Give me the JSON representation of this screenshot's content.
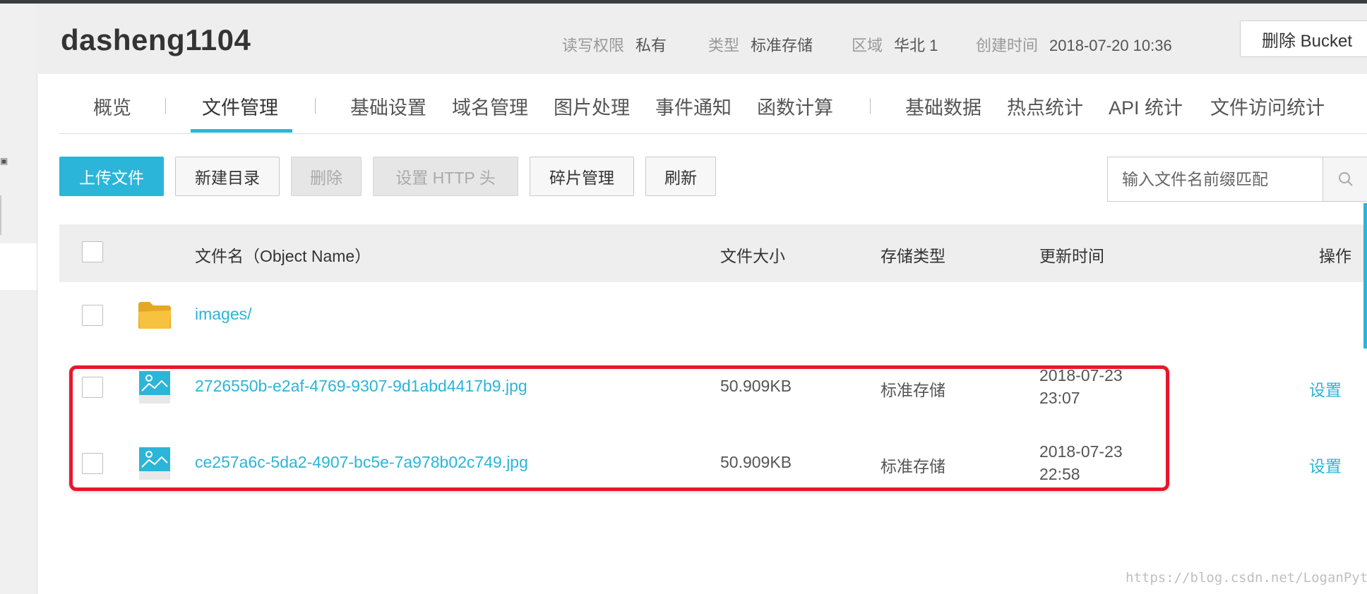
{
  "bucket": {
    "name": "dasheng1104",
    "meta": [
      {
        "key": "读写权限",
        "value": "私有"
      },
      {
        "key": "类型",
        "value": "标准存储"
      },
      {
        "key": "区域",
        "value": "华北 1"
      },
      {
        "key": "创建时间",
        "value": "2018-07-20 10:36"
      }
    ],
    "delete_label": "删除 Bucket"
  },
  "tabs": [
    {
      "label": "概览",
      "active": false
    },
    {
      "label": "文件管理",
      "active": true
    },
    {
      "label": "基础设置",
      "active": false
    },
    {
      "label": "域名管理",
      "active": false
    },
    {
      "label": "图片处理",
      "active": false
    },
    {
      "label": "事件通知",
      "active": false
    },
    {
      "label": "函数计算",
      "active": false
    },
    {
      "label": "基础数据",
      "active": false
    },
    {
      "label": "热点统计",
      "active": false
    },
    {
      "label": "API 统计",
      "active": false
    },
    {
      "label": "文件访问统计",
      "active": false
    }
  ],
  "toolbar": {
    "upload": "上传文件",
    "new_dir": "新建目录",
    "delete": "删除",
    "http_header": "设置 HTTP 头",
    "fragments": "碎片管理",
    "refresh": "刷新"
  },
  "search": {
    "placeholder": "输入文件名前缀匹配"
  },
  "table": {
    "headers": {
      "name": "文件名（Object Name）",
      "size": "文件大小",
      "storage": "存储类型",
      "updated": "更新时间",
      "action": "操作"
    },
    "rows": [
      {
        "type": "folder",
        "name": "images/",
        "size": "",
        "storage": "",
        "date": "",
        "time": "",
        "action": ""
      },
      {
        "type": "image",
        "name": "2726550b-e2af-4769-9307-9d1abd4417b9.jpg",
        "size": "50.909KB",
        "storage": "标准存储",
        "date": "2018-07-23",
        "time": "23:07",
        "action": "设置"
      },
      {
        "type": "image",
        "name": "ce257a6c-5da2-4907-bc5e-7a978b02c749.jpg",
        "size": "50.909KB",
        "storage": "标准存储",
        "date": "2018-07-23",
        "time": "22:58",
        "action": "设置"
      }
    ]
  },
  "watermark": "https://blog.csdn.net/LoganPython",
  "colors": {
    "accent": "#2bb5d8",
    "highlight": "#e8162a",
    "folder": "#f7c23f",
    "header_bg": "#eeeeee"
  }
}
